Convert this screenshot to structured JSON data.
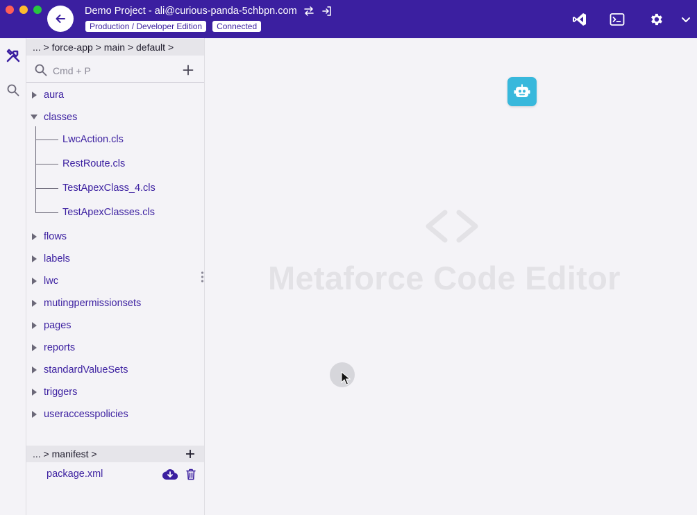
{
  "window": {
    "title_project": "Demo Project - ali@curious-panda-5chbpn.com",
    "edition_badge": "Production / Developer Edition",
    "status_badge": "Connected"
  },
  "explorer": {
    "breadcrumb": "... > force-app > main > default >",
    "search_placeholder": "Cmd + P",
    "folders": [
      {
        "label": "aura",
        "expanded": false
      },
      {
        "label": "classes",
        "expanded": true
      },
      {
        "label": "flows",
        "expanded": false
      },
      {
        "label": "labels",
        "expanded": false
      },
      {
        "label": "lwc",
        "expanded": false
      },
      {
        "label": "mutingpermissionsets",
        "expanded": false
      },
      {
        "label": "pages",
        "expanded": false
      },
      {
        "label": "reports",
        "expanded": false
      },
      {
        "label": "standardValueSets",
        "expanded": false
      },
      {
        "label": "triggers",
        "expanded": false
      },
      {
        "label": "useraccesspolicies",
        "expanded": false
      }
    ],
    "class_files": [
      "LwcAction.cls",
      "RestRoute.cls",
      "TestApexClass_4.cls",
      "TestApexClasses.cls"
    ]
  },
  "manifest": {
    "breadcrumb": "... > manifest >",
    "files": [
      "package.xml"
    ]
  },
  "editor": {
    "welcome_text": "Metaforce Code Editor"
  },
  "icons": {
    "back": "arrow-left-icon",
    "switch": "swap-icon",
    "logout": "sign-in-icon",
    "vscode": "vscode-icon",
    "terminal": "terminal-icon",
    "settings": "gear-icon",
    "menu": "chevron-down-icon",
    "tools": "tools-icon",
    "search": "search-icon",
    "add": "plus-icon",
    "download": "cloud-download-icon",
    "delete": "trash-icon",
    "assistant": "robot-icon",
    "code": "code-brackets-icon"
  },
  "colors": {
    "brand": "#3b1fa0",
    "assistant": "#38b8dc",
    "link": "#3b1fa0"
  }
}
